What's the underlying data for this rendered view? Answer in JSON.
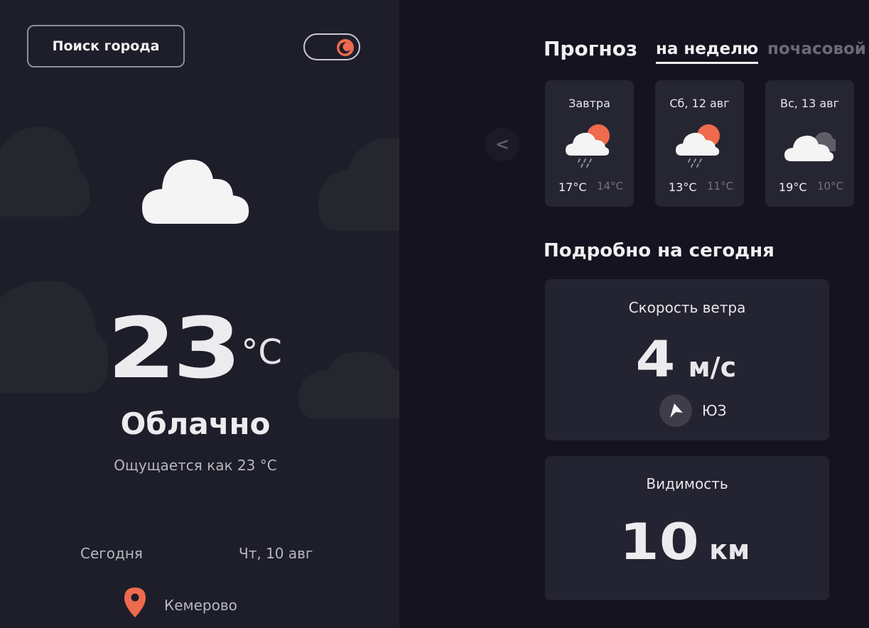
{
  "sidebar": {
    "search_button_label": "Поиск города",
    "theme_toggle_icon": "moon-icon",
    "weather_icon": "cloud-icon",
    "temperature": "23",
    "temperature_unit": "°C",
    "condition": "Облачно",
    "feels_like": "Ощущается как 23 °C",
    "date_label": "Сегодня",
    "date_value": "Чт, 10 авг",
    "location_icon": "map-pin-icon",
    "city": "Кемерово"
  },
  "forecast": {
    "title": "Прогноз",
    "tabs": [
      {
        "label": "на неделю",
        "active": true
      },
      {
        "label": "почасовой",
        "active": false
      }
    ],
    "prev_button_label": "<",
    "days": [
      {
        "label": "Завтра",
        "icon": "sun-cloud-rain-icon",
        "max": "17°C",
        "min": "14°C"
      },
      {
        "label": "Сб, 12 авг",
        "icon": "sun-cloud-rain-icon",
        "max": "13°C",
        "min": "11°C"
      },
      {
        "label": "Вс, 13 авг",
        "icon": "dark-clouds-icon",
        "max": "19°C",
        "min": "10°C"
      }
    ]
  },
  "details": {
    "title": "Подробно на сегодня",
    "wind": {
      "label": "Скорость ветра",
      "value": "4",
      "unit": "м/с",
      "direction_icon": "navigation-arrow-icon",
      "direction": "ЮЗ"
    },
    "visibility": {
      "label": "Видимость",
      "value": "10",
      "unit": "км"
    }
  },
  "colors": {
    "accent": "#ee6b4d",
    "sidebar_bg": "#1e1e2a",
    "main_bg": "#14131f",
    "card_bg": "#262633"
  }
}
